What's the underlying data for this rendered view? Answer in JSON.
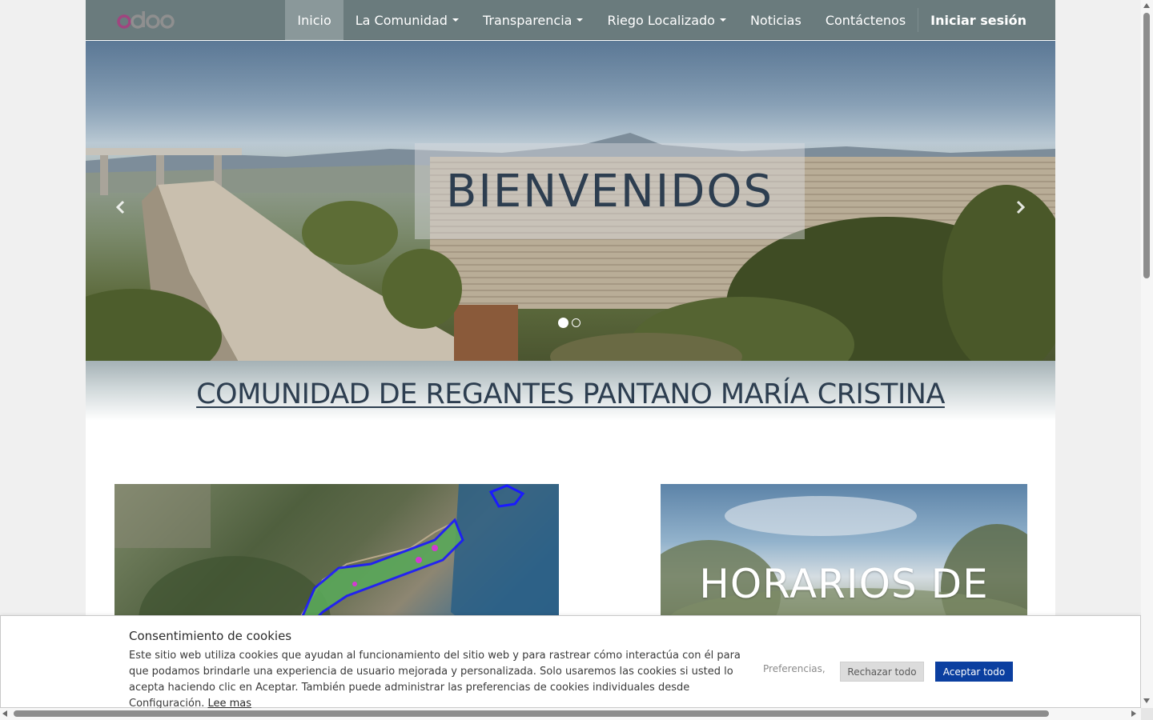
{
  "colors": {
    "navbar": "#6a7b7d",
    "nav_active": "#8a989a",
    "title_text": "#2d3e50",
    "accept_button": "#0b3fa0",
    "logo_ring": "#a0457f"
  },
  "brand": {
    "logo_text": "odoo"
  },
  "nav": {
    "items": [
      {
        "label": "Inicio",
        "active": true,
        "dropdown": false
      },
      {
        "label": "La Comunidad",
        "active": false,
        "dropdown": true
      },
      {
        "label": "Transparencia",
        "active": false,
        "dropdown": true
      },
      {
        "label": "Riego Localizado",
        "active": false,
        "dropdown": true
      },
      {
        "label": "Noticias",
        "active": false,
        "dropdown": false
      },
      {
        "label": "Contáctenos",
        "active": false,
        "dropdown": false
      }
    ],
    "login": "Iniciar sesión"
  },
  "hero": {
    "caption": "BIENVENIDOS",
    "slides_total": 2,
    "active_slide": 1,
    "prev_icon": "chevron-left-icon",
    "next_icon": "chevron-right-icon"
  },
  "main": {
    "title": "COMUNIDAD DE REGANTES PANTANO MARÍA CRISTINA",
    "right_image_text": "HORARIOS DE"
  },
  "cookie": {
    "title": "Consentimiento de cookies",
    "text": "Este sitio web utiliza cookies que ayudan al funcionamiento del sitio web y para rastrear cómo interactúa con él para que podamos brindarle una experiencia de usuario mejorada y personalizada. Solo usaremos las cookies si usted lo acepta haciendo clic en Aceptar. También puede administrar las preferencias de cookies individuales desde Configuración.",
    "more_link": "Lee mas",
    "preferences": "Preferencias,",
    "reject": "Rechazar todo",
    "accept": "Aceptar todo"
  }
}
